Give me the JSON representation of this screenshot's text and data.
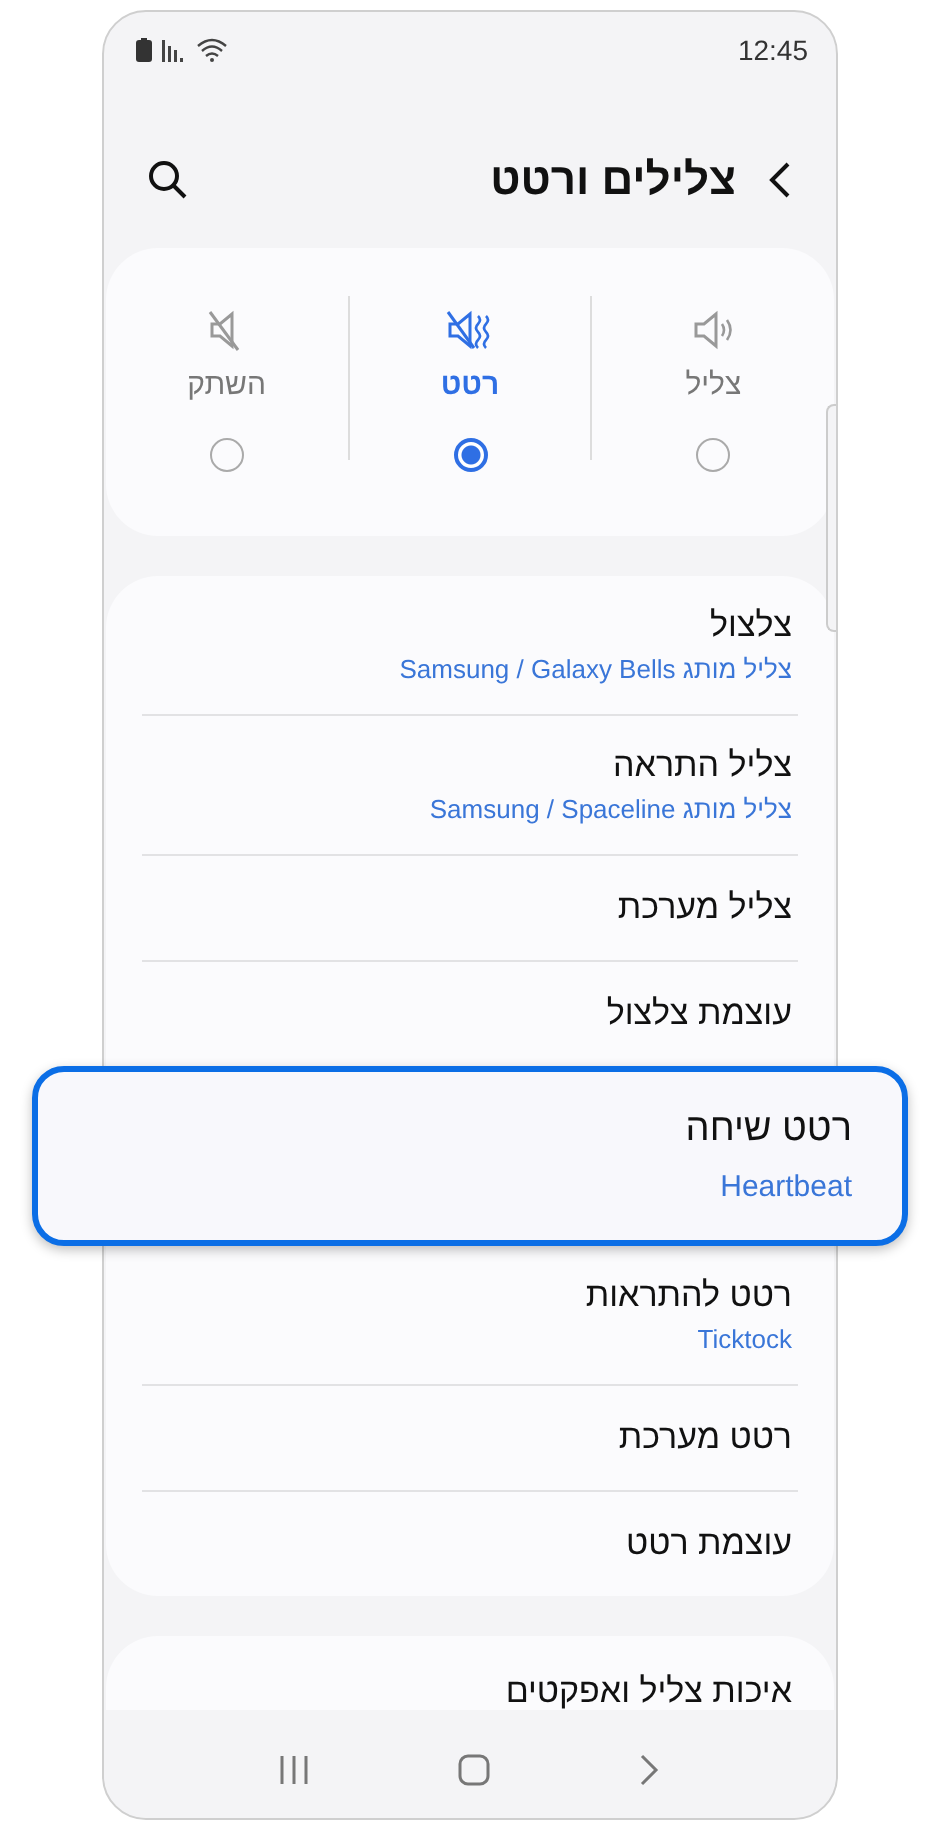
{
  "status_bar": {
    "time": "12:45"
  },
  "header": {
    "title": "צלילים ורטט"
  },
  "modes": [
    {
      "label": "צליל",
      "kind": "sound",
      "selected": false
    },
    {
      "label": "רטט",
      "kind": "vibrate",
      "selected": true
    },
    {
      "label": "השתק",
      "kind": "mute",
      "selected": false
    }
  ],
  "settings": [
    {
      "title": "צלצול",
      "subtitle": "צליל מותג Samsung / Galaxy Bells",
      "highlighted": false
    },
    {
      "title": "צליל התראה",
      "subtitle": "צליל מותג Samsung / Spaceline",
      "highlighted": false
    },
    {
      "title": "צליל מערכת",
      "highlighted": false
    },
    {
      "title": "עוצמת צלצול",
      "highlighted": false
    },
    {
      "title": "רטט שיחה",
      "subtitle": "Heartbeat",
      "highlighted": true
    },
    {
      "title": "רטט להתראות",
      "subtitle": "Ticktock",
      "highlighted": false
    },
    {
      "title": "רטט מערכת",
      "highlighted": false
    },
    {
      "title": "עוצמת רטט",
      "highlighted": false
    }
  ],
  "more_settings": [
    {
      "title": "איכות צליל ואפקטים"
    }
  ]
}
